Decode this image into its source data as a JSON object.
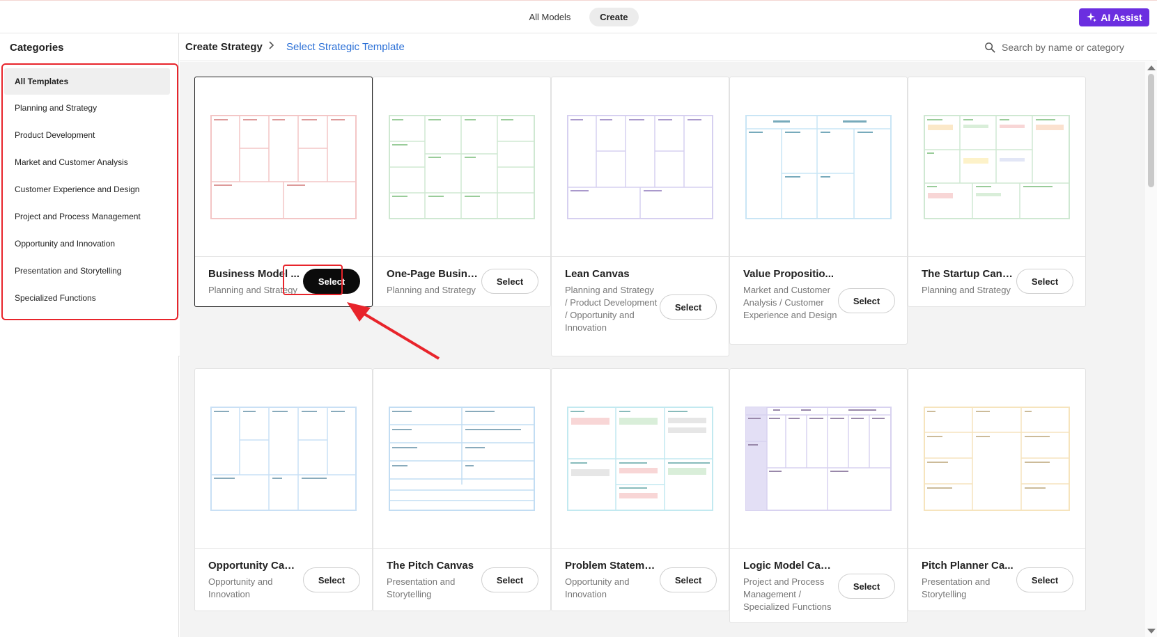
{
  "topbar": {
    "tabs": [
      {
        "label": "All Models",
        "active": false
      },
      {
        "label": "Create",
        "active": true
      }
    ],
    "ai_assist_label": "AI Assist",
    "accent_color": "#6b2ee0"
  },
  "sidebar": {
    "title": "Categories",
    "items": [
      {
        "label": "All Templates",
        "active": true
      },
      {
        "label": "Planning and Strategy",
        "active": false
      },
      {
        "label": "Product Development",
        "active": false
      },
      {
        "label": "Market and Customer Analysis",
        "active": false
      },
      {
        "label": "Customer Experience and Design",
        "active": false
      },
      {
        "label": "Project and Process Management",
        "active": false
      },
      {
        "label": "Opportunity and Innovation",
        "active": false
      },
      {
        "label": "Presentation and Storytelling",
        "active": false
      },
      {
        "label": "Specialized Functions",
        "active": false
      }
    ]
  },
  "breadcrumb": {
    "root": "Create Strategy",
    "separator": ">",
    "current": "Select Strategic Template"
  },
  "search": {
    "placeholder": "Search by name or category"
  },
  "templates": [
    {
      "title": "Business Model Canvas",
      "display_title": "Business Model ...",
      "category": "Planning and Strategy",
      "select_label": "Select",
      "selected": true,
      "theme": "#f3c6c6"
    },
    {
      "title": "One-Page Business Plan",
      "display_title": "One-Page Busine...",
      "category": "Planning and Strategy",
      "select_label": "Select",
      "selected": false,
      "theme": "#cfe8d2"
    },
    {
      "title": "Lean Canvas",
      "display_title": "Lean Canvas",
      "category": "Planning and Strategy / Product Development / Opportunity and Innovation",
      "select_label": "Select",
      "selected": false,
      "theme": "#d6d0f0"
    },
    {
      "title": "Value Proposition Canvas",
      "display_title": "Value Propositio...",
      "category": "Market and Customer Analysis / Customer Experience and Design",
      "select_label": "Select",
      "selected": false,
      "theme": "#c9e5f5"
    },
    {
      "title": "The Startup Canvas",
      "display_title": "The Startup Canv...",
      "category": "Planning and Strategy",
      "select_label": "Select",
      "selected": false,
      "theme": "#cfe8d2"
    },
    {
      "title": "Opportunity Canvas",
      "display_title": "Opportunity Canv...",
      "category": "Opportunity and Innovation",
      "select_label": "Select",
      "selected": false,
      "theme": "#c9e0f5"
    },
    {
      "title": "The Pitch Canvas",
      "display_title": "The Pitch Canvas",
      "category": "Presentation and Storytelling",
      "select_label": "Select",
      "selected": false,
      "theme": "#c2ddf3"
    },
    {
      "title": "Problem Statement Canvas",
      "display_title": "Problem Stateme...",
      "category": "Opportunity and Innovation",
      "select_label": "Select",
      "selected": false,
      "theme": "#c2e9f0"
    },
    {
      "title": "Logic Model Canvas",
      "display_title": "Logic Model Can...",
      "category": "Project and Process Management / Specialized Functions",
      "select_label": "Select",
      "selected": false,
      "theme": "#d8d2f0"
    },
    {
      "title": "Pitch Planner Canvas",
      "display_title": "Pitch Planner Ca...",
      "category": "Presentation and Storytelling",
      "select_label": "Select",
      "selected": false,
      "theme": "#f6e4bd"
    }
  ]
}
